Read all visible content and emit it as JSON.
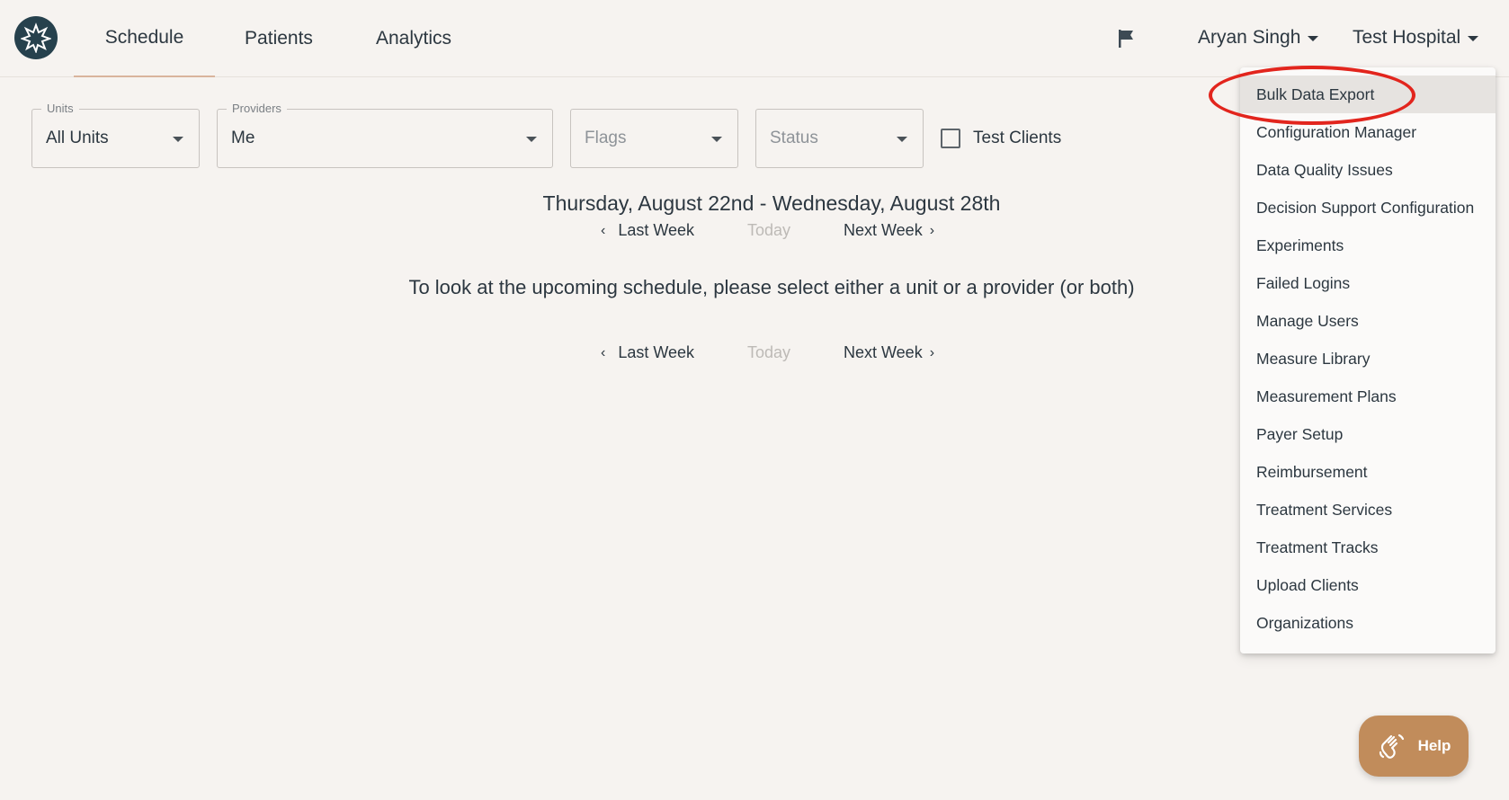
{
  "nav": {
    "tabs": [
      {
        "label": "Schedule",
        "active": true
      },
      {
        "label": "Patients",
        "active": false
      },
      {
        "label": "Analytics",
        "active": false
      }
    ],
    "user_name": "Aryan Singh",
    "organization": "Test Hospital",
    "icons": {
      "logo": "burst-logo",
      "flag": "flag-icon"
    }
  },
  "filters": {
    "units": {
      "legend": "Units",
      "value": "All Units"
    },
    "providers": {
      "legend": "Providers",
      "value": "Me"
    },
    "flags": {
      "placeholder": "Flags"
    },
    "status": {
      "placeholder": "Status"
    },
    "test_clients": {
      "label": "Test Clients",
      "checked": false
    }
  },
  "schedule": {
    "date_range": "Thursday, August 22nd - Wednesday, August 28th",
    "last_week": "Last Week",
    "today": "Today",
    "next_week": "Next Week",
    "empty_message": "To look at the upcoming schedule, please select either a unit or a provider (or both)"
  },
  "dropdown": {
    "items": [
      "Bulk Data Export",
      "Configuration Manager",
      "Data Quality Issues",
      "Decision Support Configuration",
      "Experiments",
      "Failed Logins",
      "Manage Users",
      "Measure Library",
      "Measurement Plans",
      "Payer Setup",
      "Reimbursement",
      "Treatment Services",
      "Treatment Tracks",
      "Upload Clients",
      "Organizations"
    ],
    "highlighted_item": "Bulk Data Export"
  },
  "help": {
    "label": "Help"
  },
  "colors": {
    "background": "#f6f3f0",
    "logo": "#26414d",
    "accent_underline": "#d9b49c",
    "help_button": "#c18c5b",
    "annotation": "#e2251d"
  }
}
